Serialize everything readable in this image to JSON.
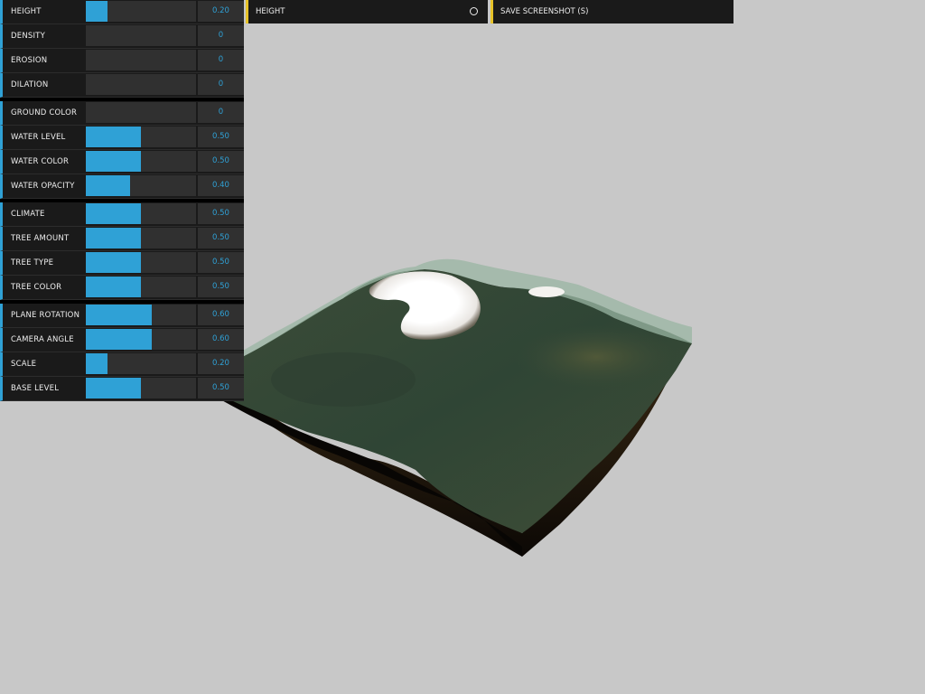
{
  "colors": {
    "background": "#c8c8c8",
    "panel": "#1a1a1a",
    "slider_fill": "#2fa1d6",
    "number_text": "#2fa1d6",
    "function_accent": "#e6c228"
  },
  "controls": {
    "groups": [
      {
        "items": [
          {
            "label": "HEIGHT",
            "value": "0.20",
            "fraction": 0.2
          },
          {
            "label": "DENSITY",
            "value": "0",
            "fraction": 0
          },
          {
            "label": "EROSION",
            "value": "0",
            "fraction": 0
          },
          {
            "label": "DILATION",
            "value": "0",
            "fraction": 0
          }
        ]
      },
      {
        "items": [
          {
            "label": "GROUND COLOR",
            "value": "0",
            "fraction": 0
          },
          {
            "label": "WATER LEVEL",
            "value": "0.50",
            "fraction": 0.5
          },
          {
            "label": "WATER COLOR",
            "value": "0.50",
            "fraction": 0.5
          },
          {
            "label": "WATER OPACITY",
            "value": "0.40",
            "fraction": 0.4
          }
        ]
      },
      {
        "items": [
          {
            "label": "CLIMATE",
            "value": "0.50",
            "fraction": 0.5
          },
          {
            "label": "TREE AMOUNT",
            "value": "0.50",
            "fraction": 0.5
          },
          {
            "label": "TREE TYPE",
            "value": "0.50",
            "fraction": 0.5
          },
          {
            "label": "TREE COLOR",
            "value": "0.50",
            "fraction": 0.5
          }
        ]
      },
      {
        "items": [
          {
            "label": "PLANE ROTATION",
            "value": "0.60",
            "fraction": 0.6
          },
          {
            "label": "CAMERA ANGLE",
            "value": "0.60",
            "fraction": 0.6
          },
          {
            "label": "SCALE",
            "value": "0.20",
            "fraction": 0.2
          },
          {
            "label": "BASE LEVEL",
            "value": "0.50",
            "fraction": 0.5
          }
        ]
      }
    ]
  },
  "top_bar": {
    "height_label": "HEIGHT",
    "height_icon": "radio-circle-icon",
    "screenshot_label": "SAVE SCREENSHOT (S)"
  }
}
